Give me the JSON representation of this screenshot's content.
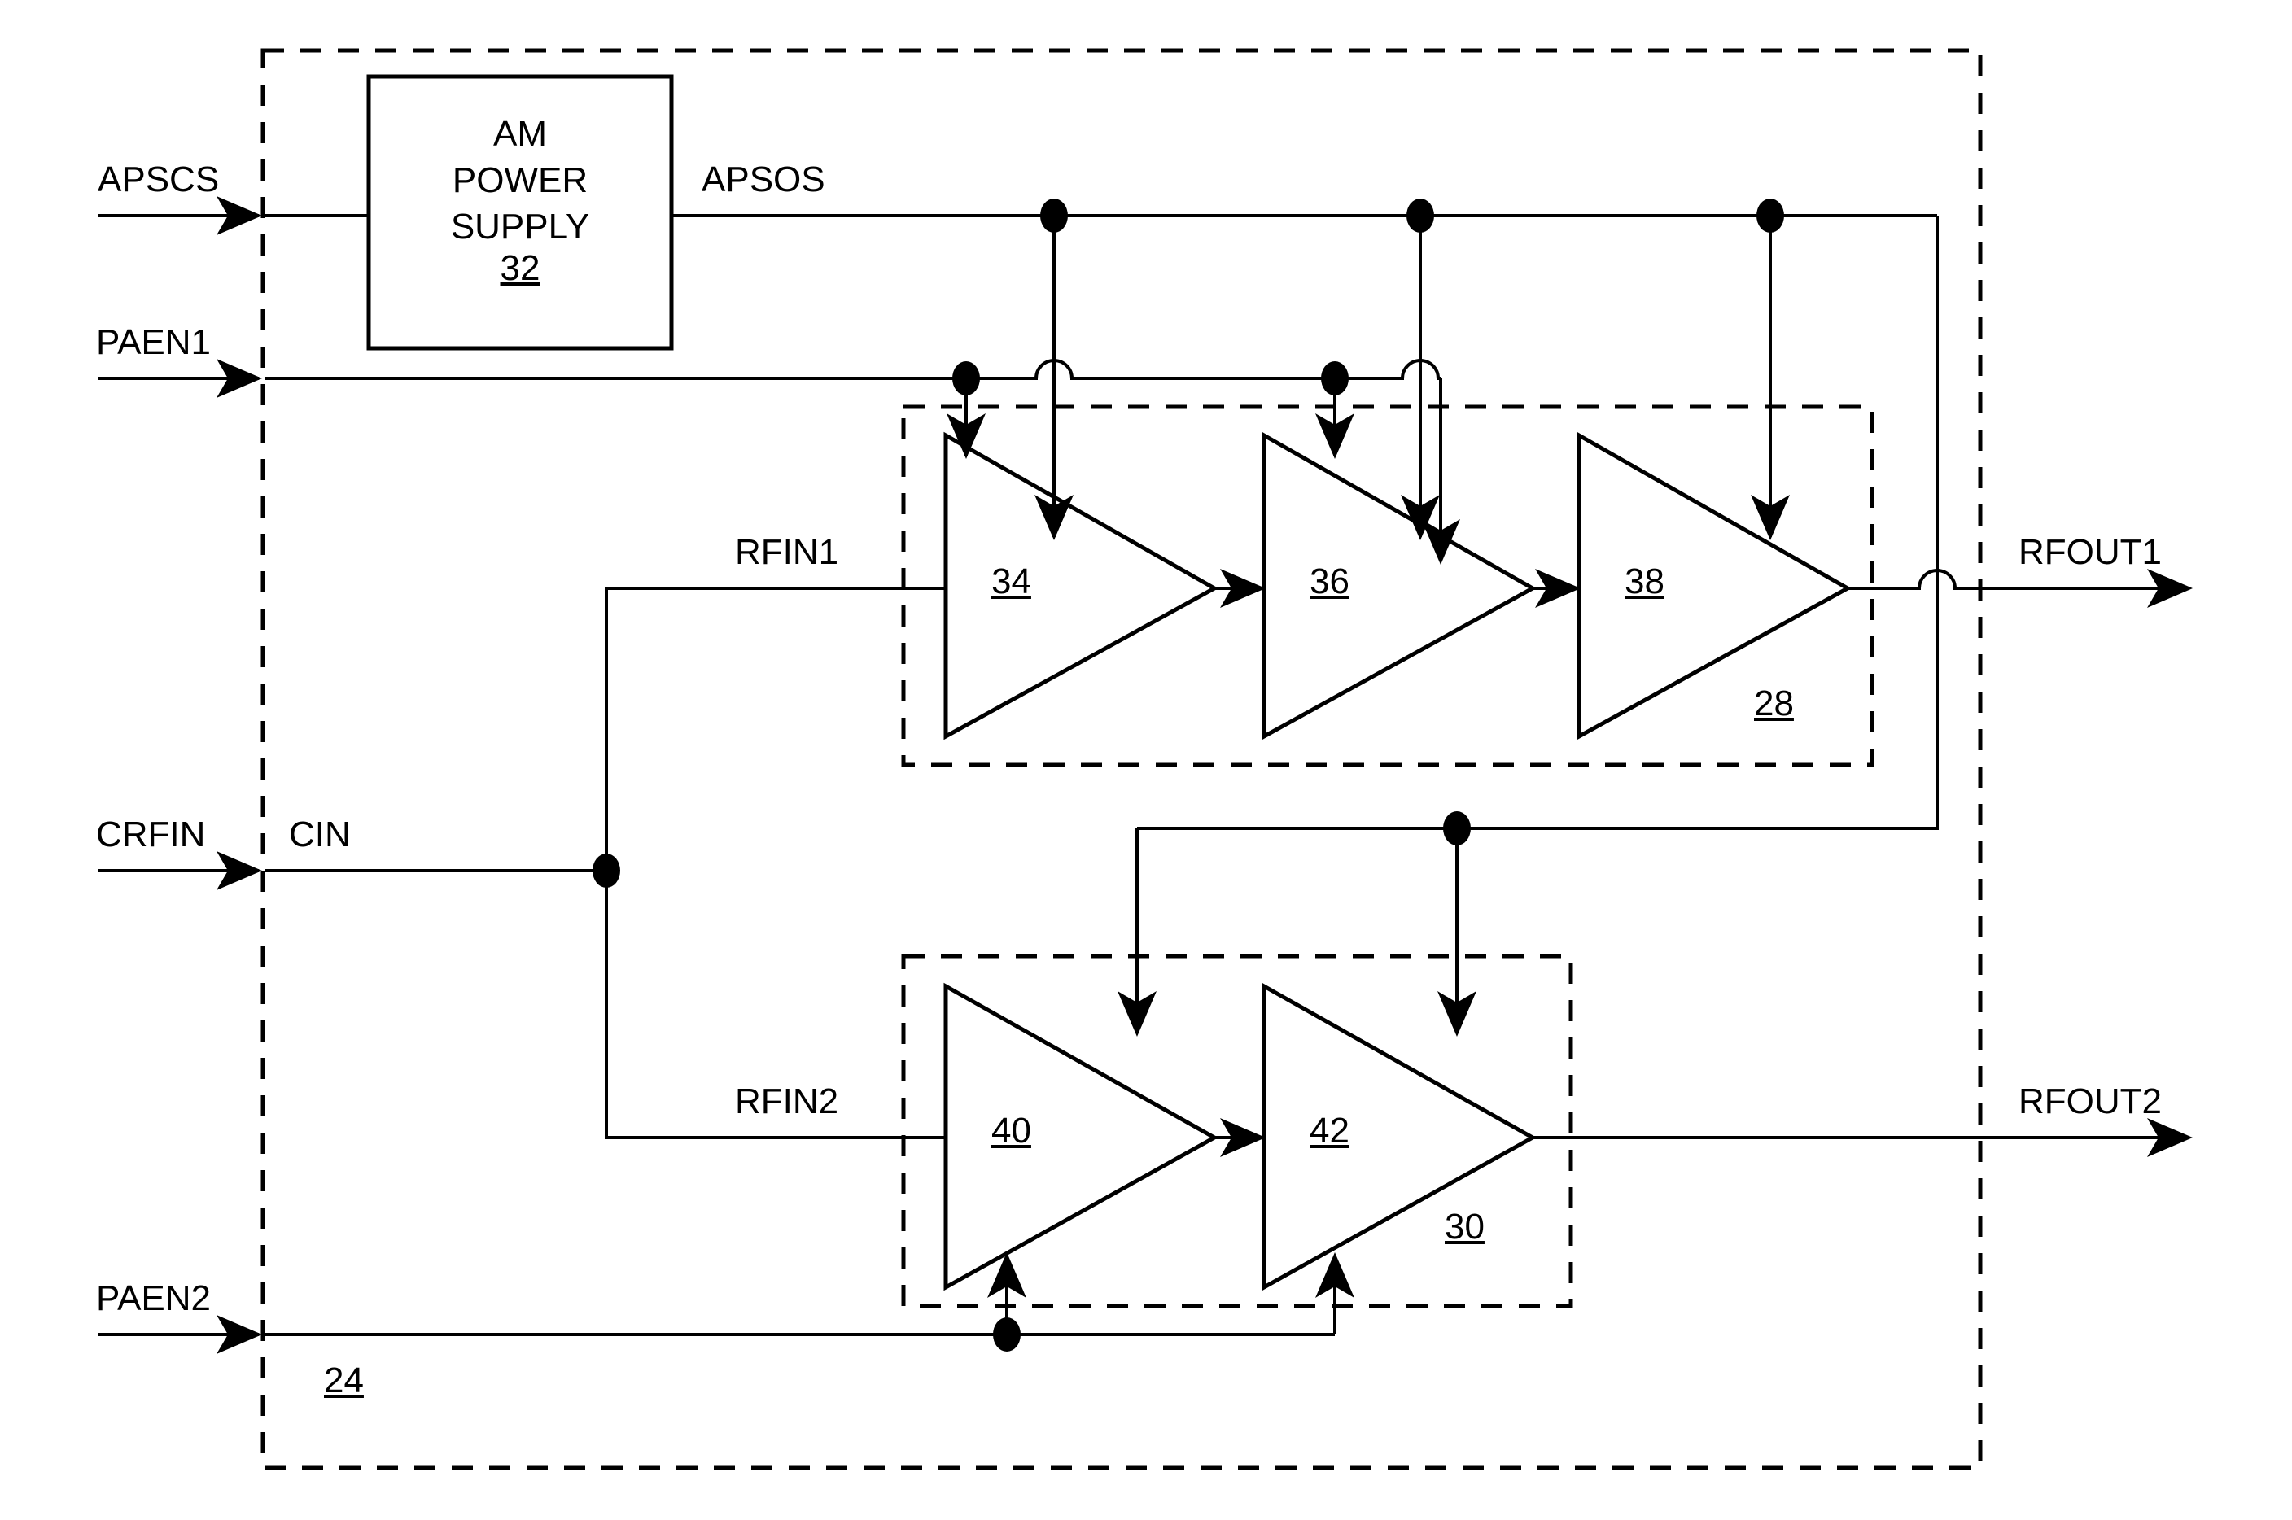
{
  "figure": {
    "type": "patent-block-diagram",
    "title": "RF power amplifier system block diagram",
    "background_color": "#ffffff",
    "line_color": "#000000"
  },
  "blocks": [
    {
      "id": "am-power-supply",
      "label_lines": [
        "AM",
        "POWER",
        "SUPPLY"
      ],
      "label": "AM POWER SUPPLY",
      "ref": "32",
      "shape": "rectangle"
    },
    {
      "id": "amplifier-34",
      "ref": "34",
      "shape": "triangle"
    },
    {
      "id": "amplifier-36",
      "ref": "36",
      "shape": "triangle"
    },
    {
      "id": "amplifier-38",
      "ref": "38",
      "shape": "triangle"
    },
    {
      "id": "amplifier-40",
      "ref": "40",
      "shape": "triangle"
    },
    {
      "id": "amplifier-42",
      "ref": "42",
      "shape": "triangle"
    }
  ],
  "groups": [
    {
      "id": "pa-chain-1",
      "ref": "28",
      "style": "dashed",
      "contains": [
        "amplifier-34",
        "amplifier-36",
        "amplifier-38"
      ]
    },
    {
      "id": "pa-chain-2",
      "ref": "30",
      "style": "dashed",
      "contains": [
        "amplifier-40",
        "amplifier-42"
      ]
    },
    {
      "id": "module-boundary",
      "ref": "24",
      "style": "dashed",
      "contains": [
        "am-power-supply",
        "pa-chain-1",
        "pa-chain-2"
      ]
    }
  ],
  "signals": {
    "apscs": "APSCS",
    "paen1": "PAEN1",
    "apsos": "APSOS",
    "crfin": "CRFIN",
    "cin": "CIN",
    "rfin1": "RFIN1",
    "rfin2": "RFIN2",
    "rfout1": "RFOUT1",
    "rfout2": "RFOUT2",
    "paen2": "PAEN2"
  },
  "refs": {
    "power_supply": "32",
    "amp_34": "34",
    "amp_36": "36",
    "amp_38": "38",
    "amp_40": "40",
    "amp_42": "42",
    "chain_28": "28",
    "chain_30": "30",
    "module_24": "24"
  }
}
